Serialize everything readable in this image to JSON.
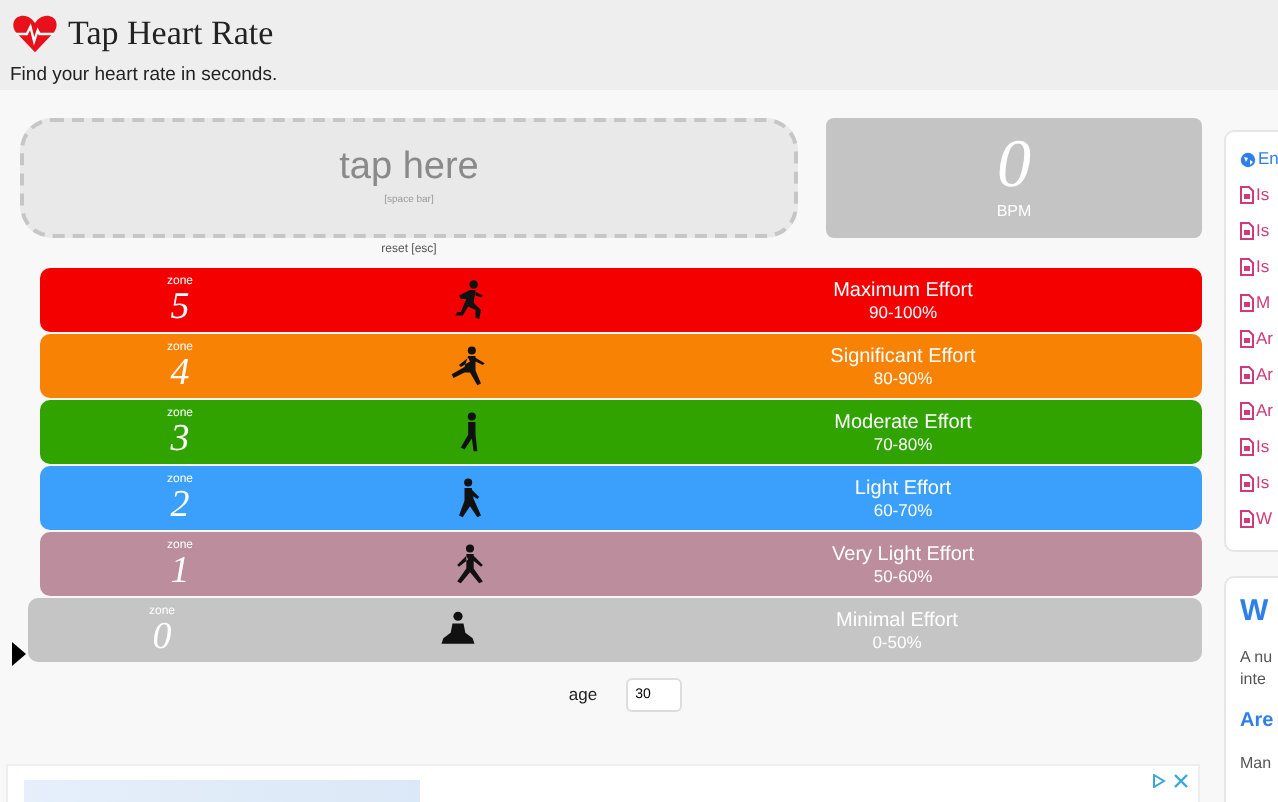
{
  "header": {
    "title": "Tap Heart Rate",
    "subtitle": "Find your heart rate in seconds."
  },
  "tap_area": {
    "label": "tap here",
    "hint": "[space bar]"
  },
  "reset": "reset [esc]",
  "bpm": {
    "value": "0",
    "unit": "BPM"
  },
  "zones": [
    {
      "caption": "zone",
      "number": "5",
      "name": "Maximum Effort",
      "range": "90-100%",
      "color": "#f40000",
      "kind": "sprint",
      "selected": false
    },
    {
      "caption": "zone",
      "number": "4",
      "name": "Significant Effort",
      "range": "80-90%",
      "color": "#f78204",
      "kind": "run",
      "selected": false
    },
    {
      "caption": "zone",
      "number": "3",
      "name": "Moderate Effort",
      "range": "70-80%",
      "color": "#30a300",
      "kind": "jog",
      "selected": false
    },
    {
      "caption": "zone",
      "number": "2",
      "name": "Light Effort",
      "range": "60-70%",
      "color": "#3aa0fc",
      "kind": "walk",
      "selected": false
    },
    {
      "caption": "zone",
      "number": "1",
      "name": "Very Light Effort",
      "range": "50-60%",
      "color": "#bc8d9d",
      "kind": "stroll",
      "selected": false
    },
    {
      "caption": "zone",
      "number": "0",
      "name": "Minimal Effort",
      "range": "0-50%",
      "color": "#c5c5c5",
      "kind": "meditate",
      "selected": true
    }
  ],
  "age": {
    "label": "age",
    "value": "30"
  },
  "sidebar": {
    "links": [
      {
        "kind": "language",
        "text": "En"
      },
      {
        "kind": "article",
        "text": "Is"
      },
      {
        "kind": "article",
        "text": "Is"
      },
      {
        "kind": "article",
        "text": "Is"
      },
      {
        "kind": "article",
        "text": "M"
      },
      {
        "kind": "article",
        "text": "Ar"
      },
      {
        "kind": "article",
        "text": "Ar"
      },
      {
        "kind": "article",
        "text": "Ar"
      },
      {
        "kind": "article",
        "text": "Is"
      },
      {
        "kind": "article",
        "text": "Is"
      },
      {
        "kind": "article",
        "text": "W"
      }
    ],
    "card": {
      "heading": "W",
      "lines": [
        "A nu",
        "inte"
      ],
      "subheading": "Are",
      "text": "Man"
    }
  }
}
